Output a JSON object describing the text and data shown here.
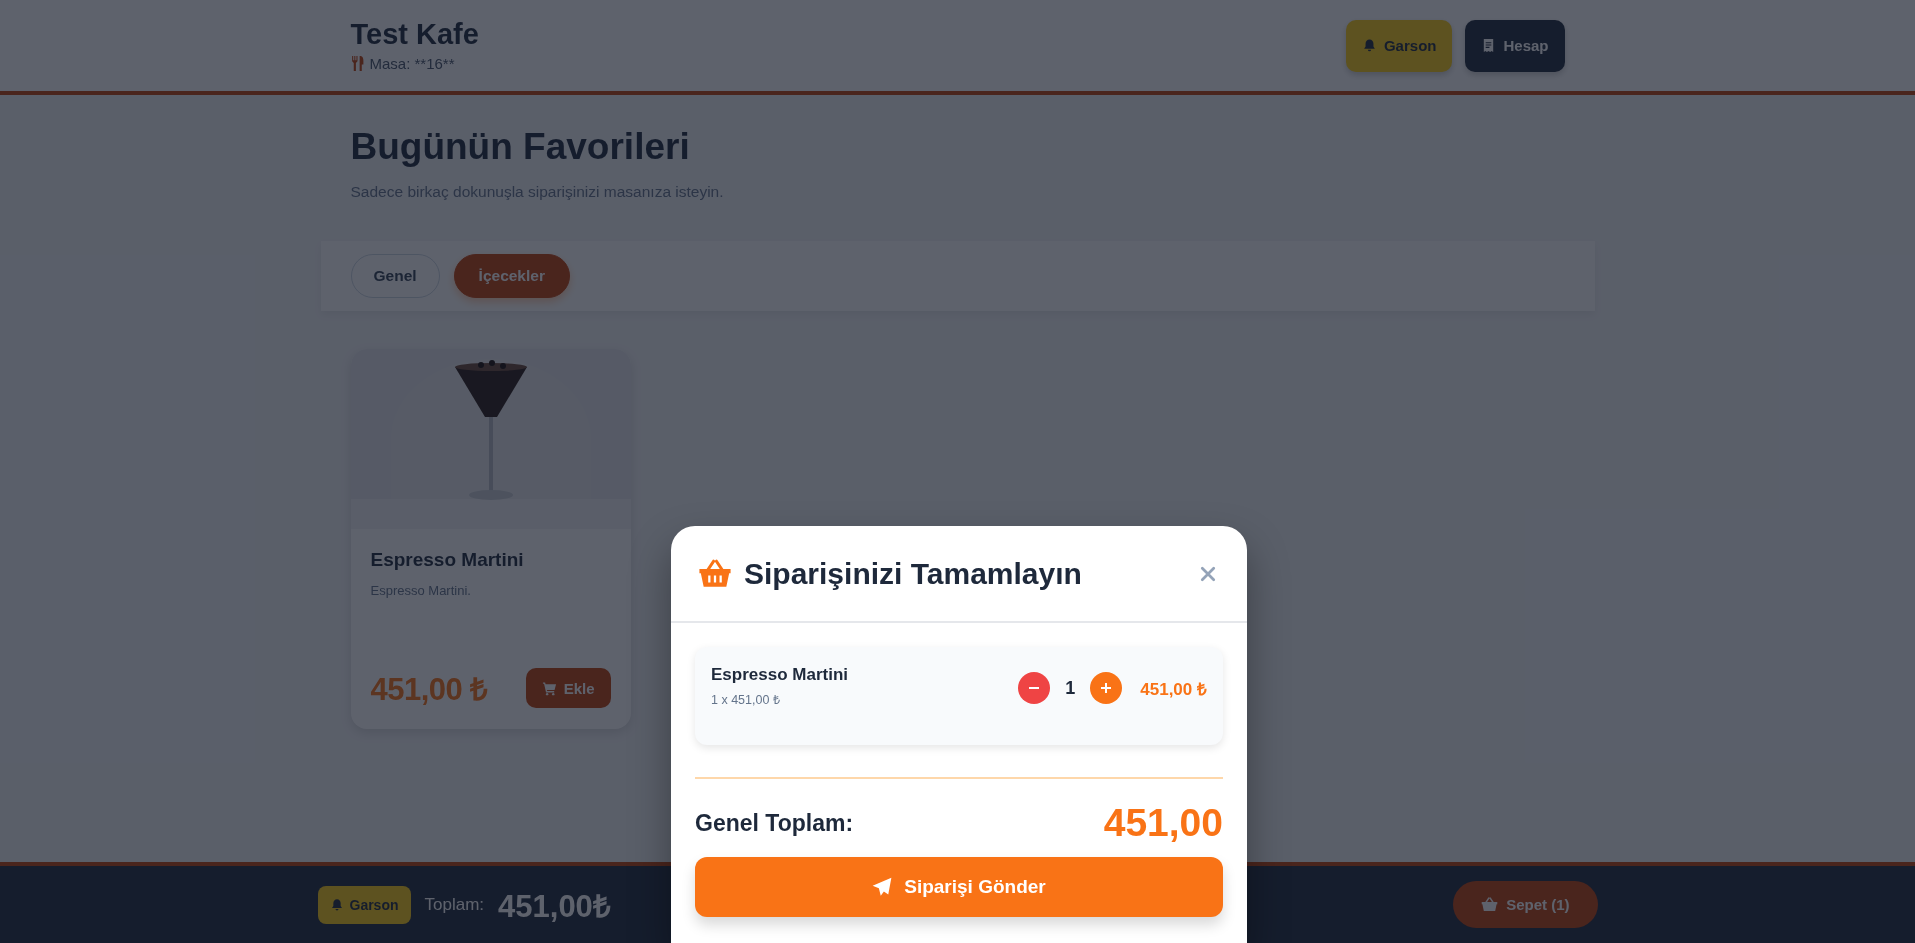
{
  "header": {
    "title": "Test Kafe",
    "table_label": "Masa: **16**",
    "buttons": [
      {
        "kind": "waiter",
        "label": "Garson"
      },
      {
        "kind": "bill",
        "label": "Hesap"
      }
    ]
  },
  "hero": {
    "title": "Bugünün Favorileri",
    "subtitle": "Sadece birkaç dokunuşla siparişinizi masanıza isteyin."
  },
  "categories": [
    {
      "label": "Genel",
      "selected": false
    },
    {
      "label": "İçecekler",
      "selected": true
    }
  ],
  "products": [
    {
      "kind": "picture",
      "name": "Espresso Martini",
      "description": "Espresso Martini.",
      "price": "451,00 ₺",
      "button": "Ekle"
    }
  ],
  "bottom_bar": {
    "waiter_button": "Garson",
    "total_label": "Toplam:",
    "total": "451,00₺",
    "cart_button": "Sepet (1)"
  },
  "modal": {
    "title": "Siparişinizi Tamamlayın",
    "items": [
      {
        "name": "Espresso Martini",
        "detail": "1 x 451,00 ₺",
        "quantity": "1",
        "line_total": "451,00 ₺"
      }
    ],
    "total_label": "Genel Toplam:",
    "total": "451,00",
    "submit": "Siparişi Gönder"
  }
}
